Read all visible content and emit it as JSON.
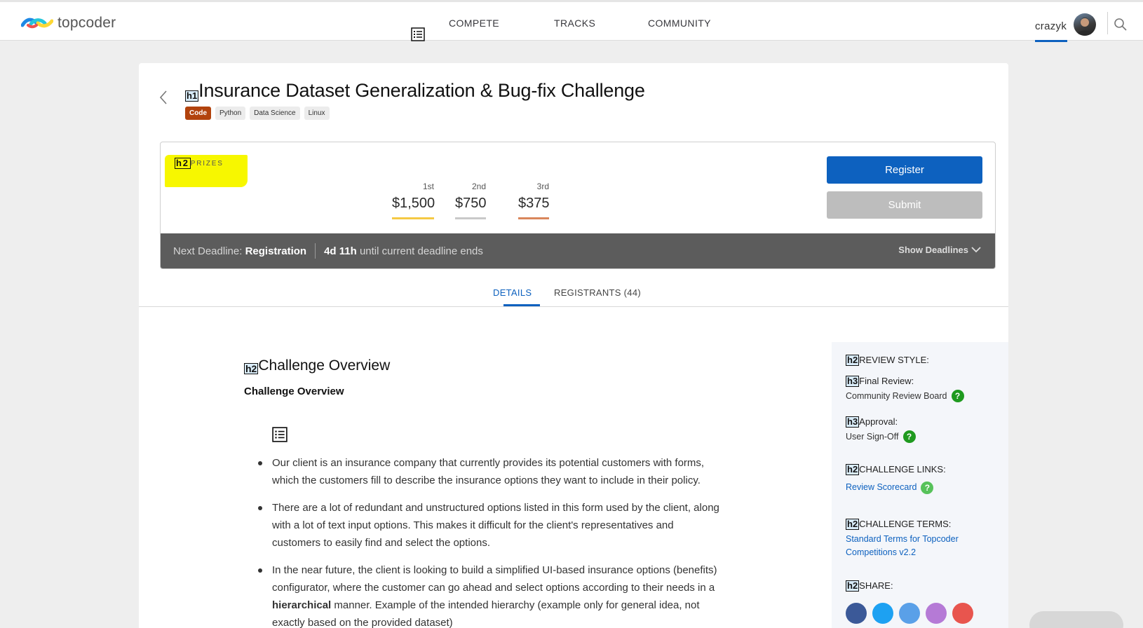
{
  "header": {
    "logo_text": "topcoder",
    "nav": [
      "COMPETE",
      "TRACKS",
      "COMMUNITY"
    ],
    "username": "crazyk"
  },
  "challenge": {
    "h1_tag": "h1",
    "title": "Insurance Dataset Generalization & Bug-fix Challenge",
    "tags": [
      "Code",
      "Python",
      "Data Science",
      "Linux"
    ]
  },
  "prizes": {
    "h2_tag": "h2",
    "label": "PRIZES",
    "items": [
      {
        "place": "1st",
        "amount": "$1,500",
        "color": "#f5c944"
      },
      {
        "place": "2nd",
        "amount": "$750",
        "color": "#c9c9c9"
      },
      {
        "place": "3rd",
        "amount": "$375",
        "color": "#d9865b"
      }
    ],
    "register_label": "Register",
    "submit_label": "Submit"
  },
  "deadline": {
    "prefix": "Next Deadline:",
    "phase": "Registration",
    "time": "4d 11h",
    "suffix": "until current deadline ends",
    "toggle_label": "Show Deadlines"
  },
  "tabs": {
    "details": "DETAILS",
    "registrants": "REGISTRANTS (44)"
  },
  "content": {
    "h2_tag": "h2",
    "heading": "Challenge Overview",
    "subheading": "Challenge Overview",
    "bullets": [
      "Our client is an insurance company that currently provides its potential customers with forms, which the customers fill to describe the insurance options they want to include in their policy.",
      "There are a lot of redundant and unstructured options listed in this form used by the client, along with a lot of text input options. This makes it difficult for the client's representatives and customers to easily find and select the options."
    ],
    "bullet3_pre": "In the near future, the client is looking to build a simplified UI-based insurance options (benefits) configurator, where the customer can go ahead and select options according to their needs in a ",
    "bullet3_bold": "hierarchical",
    "bullet3_post": " manner. Example of the intended hierarchy (example only for general idea, not exactly based on the provided dataset)"
  },
  "sidebar": {
    "h2": "h2",
    "h3": "h3",
    "review_style": "REVIEW STYLE:",
    "final_review": "Final Review:",
    "final_review_value": "Community Review Board",
    "approval": "Approval:",
    "approval_value": "User Sign-Off",
    "links_title": "CHALLENGE LINKS:",
    "scorecard_link": "Review Scorecard",
    "terms_title": "CHALLENGE TERMS:",
    "terms_link": "Standard Terms for Topcoder Competitions v2.2",
    "share_title": "SHARE:",
    "share_colors": [
      "#3b5998",
      "#1da1f2",
      "#5aa0e8",
      "#b57ad6",
      "#e8554e"
    ]
  },
  "colors": {
    "accent": "#0d61bf",
    "code_tag": "#b2430d",
    "highlight": "#f7f700"
  }
}
